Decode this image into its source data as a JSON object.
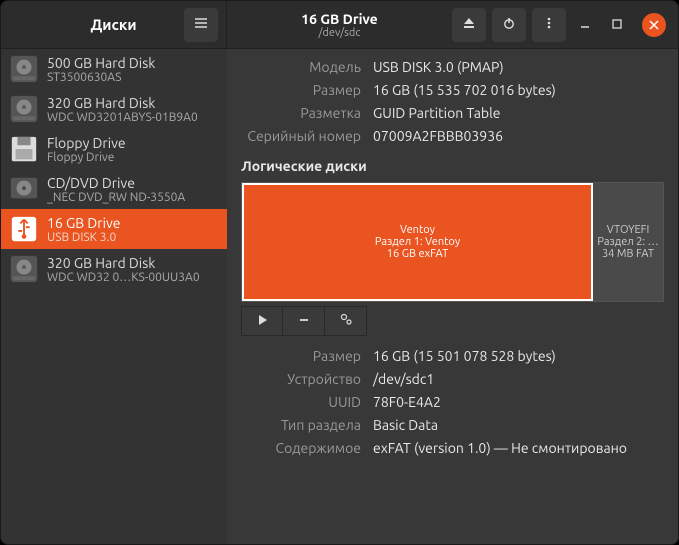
{
  "titlebar": {
    "app_title": "Диски",
    "drive_title": "16 GB Drive",
    "drive_subtitle": "/dev/sdc"
  },
  "sidebar": {
    "items": [
      {
        "name": "500 GB Hard Disk",
        "sub": "ST3500630AS",
        "icon": "hdd"
      },
      {
        "name": "320 GB Hard Disk",
        "sub": "WDC WD3201ABYS-01B9A0",
        "icon": "hdd"
      },
      {
        "name": "Floppy Drive",
        "sub": "Floppy Drive",
        "icon": "floppy"
      },
      {
        "name": "CD/DVD Drive",
        "sub": "_NEC DVD_RW ND-3550A",
        "icon": "optical"
      },
      {
        "name": "16 GB Drive",
        "sub": "USB DISK 3.0",
        "icon": "usb"
      },
      {
        "name": "320 GB Hard Disk",
        "sub": "WDC WD32 0…KS-00UU3A0",
        "icon": "hdd"
      }
    ]
  },
  "drive_info": {
    "model_label": "Модель",
    "model_value": "USB DISK 3.0 (PMAP)",
    "size_label": "Размер",
    "size_value": "16 GB (15 535 702 016 bytes)",
    "part_label": "Разметка",
    "part_value": "GUID Partition Table",
    "serial_label": "Серийный номер",
    "serial_value": "07009A2FBBB03936"
  },
  "volumes_header": "Логические диски",
  "volumes": [
    {
      "name": "Ventoy",
      "detail": "Раздел 1: Ventoy",
      "fs": "16 GB exFAT"
    },
    {
      "name": "VTOYEFI",
      "detail": "Раздел 2: …",
      "fs": "34 MB FAT"
    }
  ],
  "partition_info": {
    "size_label": "Размер",
    "size_value": "16 GB (15 501 078 528 bytes)",
    "device_label": "Устройство",
    "device_value": "/dev/sdc1",
    "uuid_label": "UUID",
    "uuid_value": "78F0-E4A2",
    "type_label": "Тип раздела",
    "type_value": "Basic Data",
    "content_label": "Содержимое",
    "content_value": "exFAT (version 1.0) — Не смонтировано"
  }
}
